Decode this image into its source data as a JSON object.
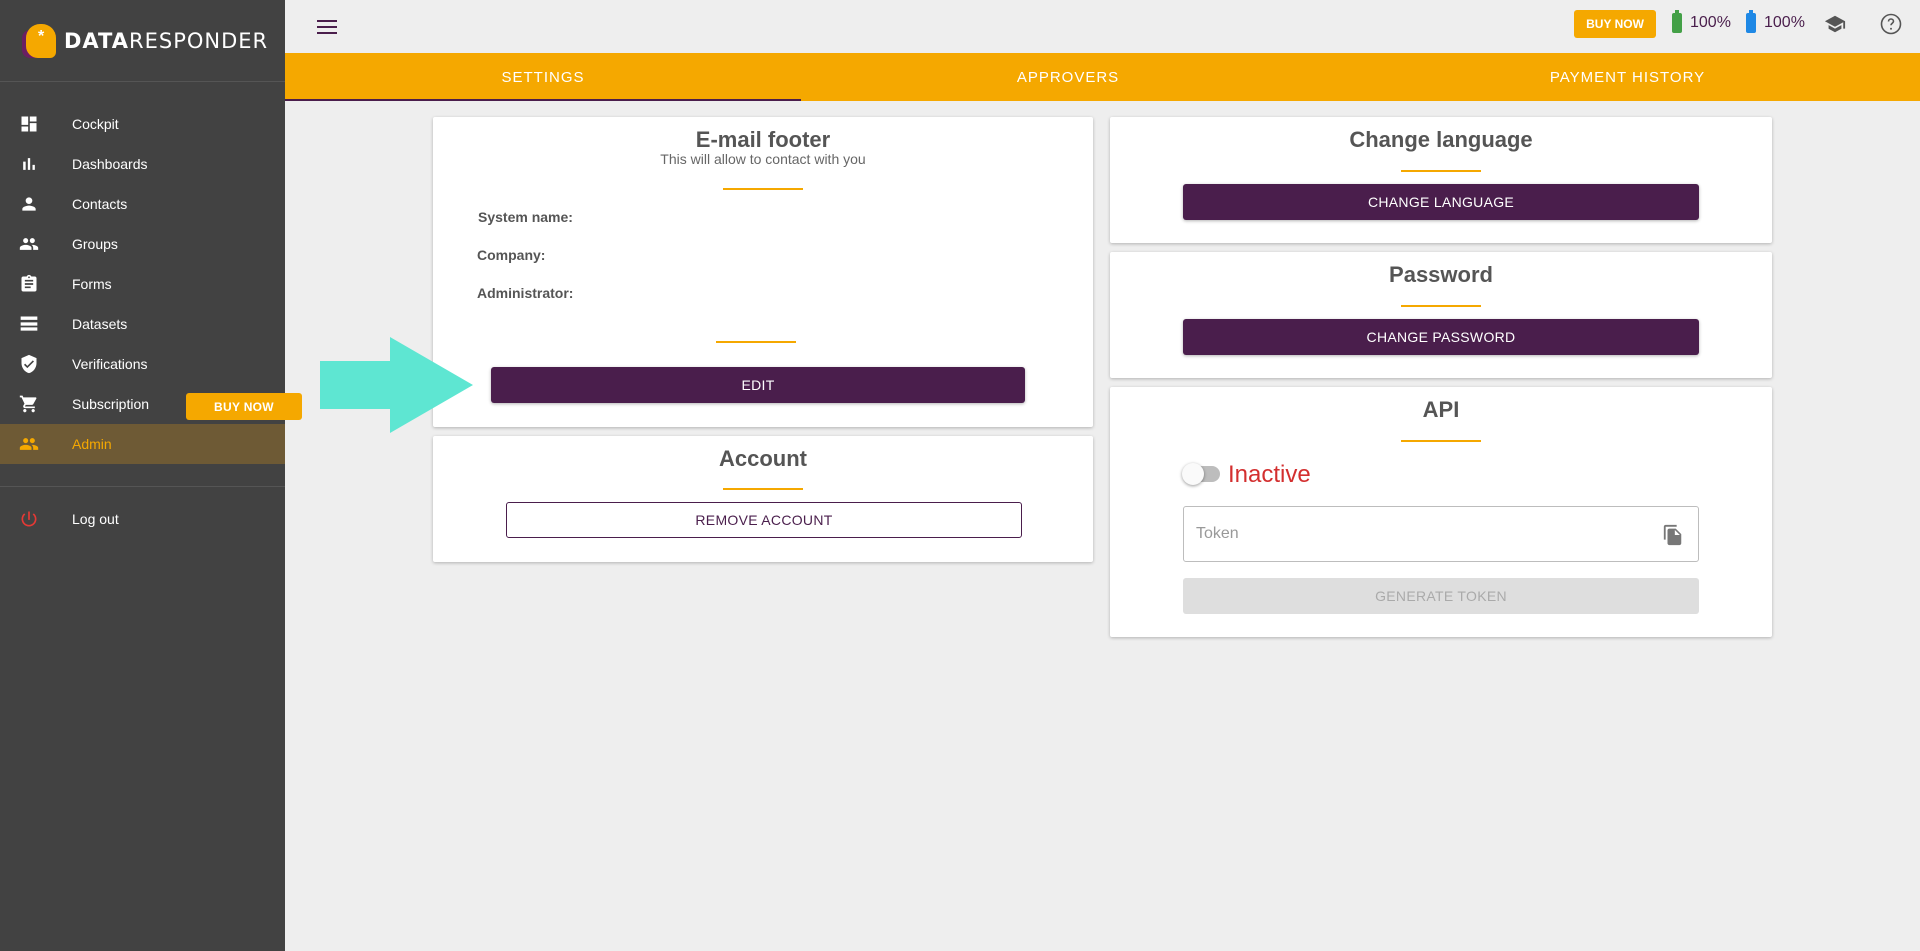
{
  "sidebar": {
    "logo": {
      "bold": "DATA",
      "light": "RESPONDER"
    },
    "items": [
      {
        "label": "Cockpit",
        "icon": "dashboard-icon"
      },
      {
        "label": "Dashboards",
        "icon": "bar-chart-icon"
      },
      {
        "label": "Contacts",
        "icon": "person-icon"
      },
      {
        "label": "Groups",
        "icon": "people-icon"
      },
      {
        "label": "Forms",
        "icon": "clipboard-icon"
      },
      {
        "label": "Datasets",
        "icon": "list-icon"
      },
      {
        "label": "Verifications",
        "icon": "shield-icon"
      },
      {
        "label": "Subscription",
        "icon": "cart-icon"
      },
      {
        "label": "Admin",
        "icon": "admin-people-icon"
      }
    ],
    "buy_now": "BUY NOW",
    "logout": "Log out"
  },
  "topbar": {
    "buy_now": "BUY NOW",
    "battery_green": "100%",
    "battery_blue": "100%"
  },
  "tabs": [
    {
      "label": "SETTINGS",
      "active": true
    },
    {
      "label": "APPROVERS",
      "active": false
    },
    {
      "label": "PAYMENT HISTORY",
      "active": false
    }
  ],
  "email_footer": {
    "title": "E-mail footer",
    "subtitle": "This will allow to contact with you",
    "system_name_label": "System name:",
    "company_label": "Company:",
    "administrator_label": "Administrator:",
    "edit_button": "EDIT"
  },
  "account": {
    "title": "Account",
    "remove_button": "REMOVE ACCOUNT"
  },
  "language": {
    "title": "Change language",
    "button": "CHANGE LANGUAGE"
  },
  "password": {
    "title": "Password",
    "button": "CHANGE PASSWORD"
  },
  "api": {
    "title": "API",
    "status": "Inactive",
    "token_placeholder": "Token",
    "generate_button": "GENERATE TOKEN"
  },
  "colors": {
    "accent": "#f5a800",
    "primary": "#4a1e4c",
    "sidebar": "#424242",
    "arrow": "#5ee6d2",
    "inactive": "#d32f2f"
  }
}
